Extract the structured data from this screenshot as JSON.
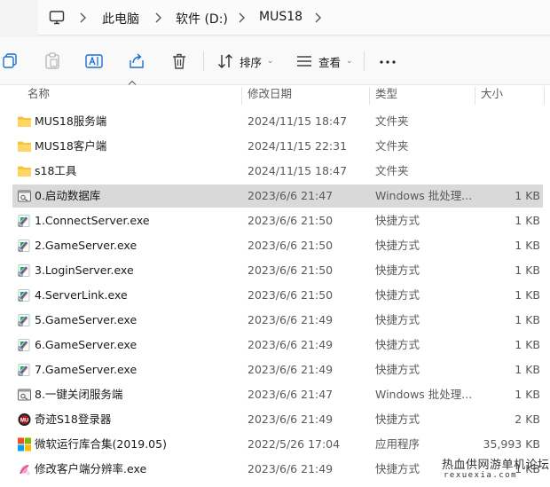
{
  "breadcrumb": {
    "items": [
      "此电脑",
      "软件 (D:)",
      "MUS18"
    ]
  },
  "toolbar": {
    "sort_label": "排序",
    "view_label": "查看",
    "more_label": "···",
    "icons": [
      "copy-icon",
      "paste-icon",
      "rename-icon",
      "share-icon",
      "delete-icon",
      "sort-icon",
      "view-icon",
      "more-icon"
    ]
  },
  "columns": {
    "name": "名称",
    "date": "修改日期",
    "type": "类型",
    "size": "大小"
  },
  "files": [
    {
      "name": "MUS18服务端",
      "date": "2024/11/15 18:47",
      "type": "文件夹",
      "size": "",
      "icon": "folder-icon"
    },
    {
      "name": "MUS18客户端",
      "date": "2024/11/15 22:31",
      "type": "文件夹",
      "size": "",
      "icon": "folder-icon"
    },
    {
      "name": "s18工具",
      "date": "2024/11/15 18:47",
      "type": "文件夹",
      "size": "",
      "icon": "folder-icon"
    },
    {
      "name": "0.启动数据库",
      "date": "2023/6/6 21:47",
      "type": "Windows 批处理...",
      "size": "1 KB",
      "icon": "batch-file-icon",
      "selected": true
    },
    {
      "name": "1.ConnectServer.exe",
      "date": "2023/6/6 21:50",
      "type": "快捷方式",
      "size": "1 KB",
      "icon": "shortcut-icon"
    },
    {
      "name": "2.GameServer.exe",
      "date": "2023/6/6 21:50",
      "type": "快捷方式",
      "size": "1 KB",
      "icon": "shortcut-icon"
    },
    {
      "name": "3.LoginServer.exe",
      "date": "2023/6/6 21:50",
      "type": "快捷方式",
      "size": "1 KB",
      "icon": "shortcut-icon"
    },
    {
      "name": "4.ServerLink.exe",
      "date": "2023/6/6 21:50",
      "type": "快捷方式",
      "size": "1 KB",
      "icon": "shortcut-icon"
    },
    {
      "name": "5.GameServer.exe",
      "date": "2023/6/6 21:49",
      "type": "快捷方式",
      "size": "1 KB",
      "icon": "shortcut-icon"
    },
    {
      "name": "6.GameServer.exe",
      "date": "2023/6/6 21:49",
      "type": "快捷方式",
      "size": "1 KB",
      "icon": "shortcut-icon"
    },
    {
      "name": "7.GameServer.exe",
      "date": "2023/6/6 21:49",
      "type": "快捷方式",
      "size": "1 KB",
      "icon": "shortcut-icon"
    },
    {
      "name": "8.一键关闭服务端",
      "date": "2023/6/6 21:47",
      "type": "Windows 批处理...",
      "size": "1 KB",
      "icon": "batch-file-icon"
    },
    {
      "name": "奇迹S18登录器",
      "date": "2023/6/6 21:49",
      "type": "快捷方式",
      "size": "2 KB",
      "icon": "game-launcher-icon"
    },
    {
      "name": "微软运行库合集(2019.05)",
      "date": "2022/5/26 17:04",
      "type": "应用程序",
      "size": "35,993 KB",
      "icon": "windows-logo-icon"
    },
    {
      "name": "修改客户端分辨率.exe",
      "date": "2023/6/6 21:49",
      "type": "快捷方式",
      "size": "1 KB",
      "icon": "resolution-tool-icon"
    }
  ],
  "watermark": {
    "line1": "热血供网游单机论坛",
    "line2": "rexuexia.com"
  },
  "colors": {
    "folder": "#f5c542",
    "selected_row": "#d9d9d9",
    "accent": "#1a6fd1"
  }
}
